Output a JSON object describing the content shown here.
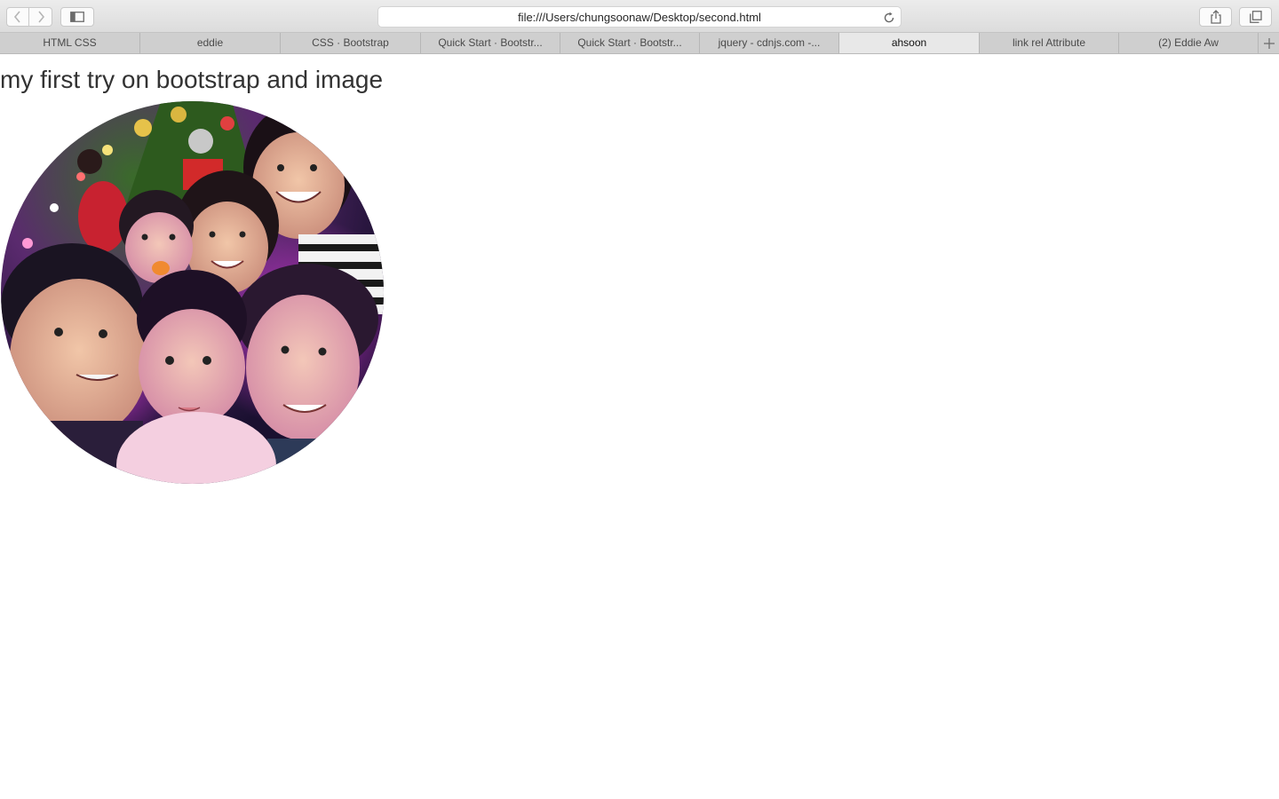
{
  "window": {
    "address_url": "file:///Users/chungsoonaw/Desktop/second.html"
  },
  "toolbar": {
    "back_icon": "chevron-left-icon",
    "forward_icon": "chevron-right-icon",
    "sidebar_icon": "sidebar-icon",
    "share_icon": "share-icon",
    "tabs_icon": "tab-overview-icon",
    "reload_icon": "reload-icon"
  },
  "tabs": [
    {
      "label": "HTML CSS",
      "active": false
    },
    {
      "label": "eddie",
      "active": false
    },
    {
      "label": "CSS · Bootstrap",
      "active": false
    },
    {
      "label": "Quick Start · Bootstr...",
      "active": false
    },
    {
      "label": "Quick Start · Bootstr...",
      "active": false
    },
    {
      "label": "jquery - cdnjs.com -...",
      "active": false
    },
    {
      "label": "ahsoon",
      "active": true
    },
    {
      "label": "link rel Attribute",
      "active": false
    },
    {
      "label": "(2) Eddie Aw",
      "active": false
    }
  ],
  "new_tab_icon": "plus-icon",
  "page": {
    "heading": "my first try on bootstrap and image",
    "image": {
      "shape": "circle",
      "subject": "family-selfie-photo"
    }
  }
}
